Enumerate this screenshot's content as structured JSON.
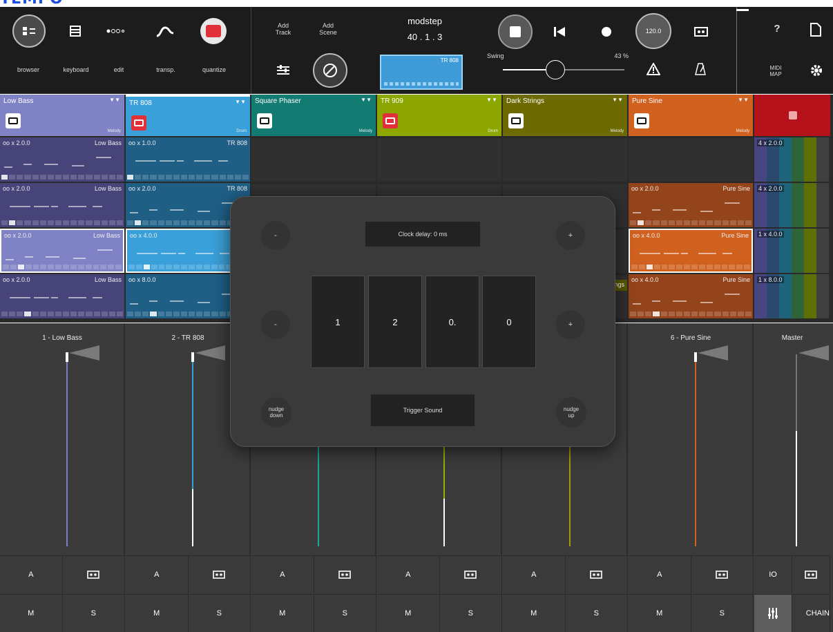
{
  "header_label": "TEMPO",
  "toolbar": {
    "left_top": [
      {
        "icon": "browser-icon"
      },
      {
        "icon": "keyboard-icon"
      },
      {
        "icon": "edit-icon"
      },
      {
        "icon": "transpose-icon"
      },
      {
        "icon": "quantize-icon"
      }
    ],
    "left_labels": [
      "browser",
      "keyboard",
      "edit",
      "transp.",
      "quantize"
    ],
    "add_track": "Add\nTrack",
    "add_scene": "Add\nScene",
    "app_title": "modstep",
    "position": "40 . 1 . 3",
    "mini_clip_label": "TR 808",
    "swing_label": "Swing",
    "swing_value": "43 %",
    "swing_fraction": 0.43,
    "tempo": "120.0",
    "help": "?",
    "midi_map": "MIDI\nMAP"
  },
  "tracks": [
    {
      "name": "Low Bass",
      "type": "Melody",
      "color": "#8082c6",
      "clipcolor": "#47447a",
      "mixer_name": "1 - Low Bass",
      "fader_color": "#7c7fc5",
      "fader_level": 0.0,
      "clips": [
        {
          "l": "oo x  2.0.0",
          "r": "Low Bass"
        },
        {
          "l": "oo x  2.0.0",
          "r": "Low Bass"
        },
        {
          "l": "oo x 2.0.0",
          "r": "Low Bass",
          "active": true
        },
        {
          "l": "oo x  2.0.0",
          "r": "Low Bass"
        }
      ]
    },
    {
      "name": "TR 808",
      "type": "Drum",
      "color": "#3aa0d9",
      "clipcolor": "#1f5f86",
      "mixer_name": "2 - TR 808",
      "fader_color": "#3aa0d9",
      "fader_level": 0.3,
      "clips": [
        {
          "l": "oo x  1.0.0",
          "r": "TR 808"
        },
        {
          "l": "oo x  2.0.0",
          "r": "TR 808"
        },
        {
          "l": "oo x  4.0.0",
          "r": "",
          "active": true
        },
        {
          "l": "oo x  8.0.0",
          "r": ""
        }
      ]
    },
    {
      "name": "Square Phaser",
      "type": "Melody",
      "color": "#127c73",
      "clipcolor": "#0e5c55",
      "mixer_name": "",
      "fader_color": "#1aa89b",
      "fader_level": 0.0,
      "clips": []
    },
    {
      "name": "TR 909",
      "type": "Drum",
      "color": "#8ea600",
      "clipcolor": "#6f8200",
      "mixer_name": "",
      "fader_color": "#9bb200",
      "fader_level": 0.25,
      "clips": []
    },
    {
      "name": "Dark Strings",
      "type": "Melody",
      "color": "#6c6a00",
      "clipcolor": "#5a5800",
      "mixer_name": "",
      "fader_color": "#a89a00",
      "fader_level": 0.0,
      "clips": []
    },
    {
      "name": "Pure Sine",
      "type": "Melody",
      "color": "#d1611f",
      "clipcolor": "#94441a",
      "mixer_name": "6 - Pure Sine",
      "fader_color": "#d1611f",
      "fader_level": 0.0,
      "clips": [
        {
          "l": "",
          "r": ""
        },
        {
          "l": "oo x  2.0.0",
          "r": "Pure Sine"
        },
        {
          "l": "oo x 4.0.0",
          "r": "Pure Sine",
          "active": true
        },
        {
          "l": "oo x  4.0.0",
          "r": "Pure Sine"
        }
      ]
    }
  ],
  "strings_clip_label": "ngs",
  "master": {
    "label": "Master",
    "clips": [
      "4 x  2.0.0",
      "4 x  2.0.0",
      "1 x  4.0.0",
      "1 x  8.0.0"
    ],
    "io": "IO",
    "chain": "CHAIN",
    "fader_level": 0.6
  },
  "mixer_buttons": {
    "a": "A",
    "m": "M",
    "s": "S"
  },
  "dialog": {
    "minus": "-",
    "plus": "+",
    "clock_delay": "Clock delay: 0 ms",
    "digits": [
      "1",
      "2",
      "0.",
      "0"
    ],
    "nudge_down": "nudge\ndown",
    "nudge_up": "nudge\nup",
    "trigger": "Trigger Sound"
  }
}
